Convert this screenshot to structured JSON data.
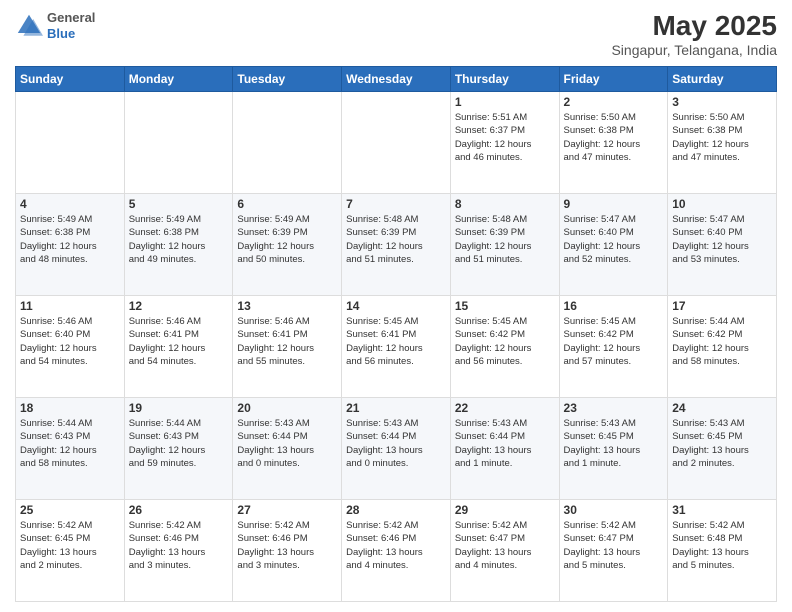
{
  "header": {
    "logo": {
      "general": "General",
      "blue": "Blue"
    },
    "title": "May 2025",
    "subtitle": "Singapur, Telangana, India"
  },
  "days_of_week": [
    "Sunday",
    "Monday",
    "Tuesday",
    "Wednesday",
    "Thursday",
    "Friday",
    "Saturday"
  ],
  "weeks": [
    [
      {
        "day": "",
        "info": ""
      },
      {
        "day": "",
        "info": ""
      },
      {
        "day": "",
        "info": ""
      },
      {
        "day": "",
        "info": ""
      },
      {
        "day": "1",
        "info": "Sunrise: 5:51 AM\nSunset: 6:37 PM\nDaylight: 12 hours\nand 46 minutes."
      },
      {
        "day": "2",
        "info": "Sunrise: 5:50 AM\nSunset: 6:38 PM\nDaylight: 12 hours\nand 47 minutes."
      },
      {
        "day": "3",
        "info": "Sunrise: 5:50 AM\nSunset: 6:38 PM\nDaylight: 12 hours\nand 47 minutes."
      }
    ],
    [
      {
        "day": "4",
        "info": "Sunrise: 5:49 AM\nSunset: 6:38 PM\nDaylight: 12 hours\nand 48 minutes."
      },
      {
        "day": "5",
        "info": "Sunrise: 5:49 AM\nSunset: 6:38 PM\nDaylight: 12 hours\nand 49 minutes."
      },
      {
        "day": "6",
        "info": "Sunrise: 5:49 AM\nSunset: 6:39 PM\nDaylight: 12 hours\nand 50 minutes."
      },
      {
        "day": "7",
        "info": "Sunrise: 5:48 AM\nSunset: 6:39 PM\nDaylight: 12 hours\nand 51 minutes."
      },
      {
        "day": "8",
        "info": "Sunrise: 5:48 AM\nSunset: 6:39 PM\nDaylight: 12 hours\nand 51 minutes."
      },
      {
        "day": "9",
        "info": "Sunrise: 5:47 AM\nSunset: 6:40 PM\nDaylight: 12 hours\nand 52 minutes."
      },
      {
        "day": "10",
        "info": "Sunrise: 5:47 AM\nSunset: 6:40 PM\nDaylight: 12 hours\nand 53 minutes."
      }
    ],
    [
      {
        "day": "11",
        "info": "Sunrise: 5:46 AM\nSunset: 6:40 PM\nDaylight: 12 hours\nand 54 minutes."
      },
      {
        "day": "12",
        "info": "Sunrise: 5:46 AM\nSunset: 6:41 PM\nDaylight: 12 hours\nand 54 minutes."
      },
      {
        "day": "13",
        "info": "Sunrise: 5:46 AM\nSunset: 6:41 PM\nDaylight: 12 hours\nand 55 minutes."
      },
      {
        "day": "14",
        "info": "Sunrise: 5:45 AM\nSunset: 6:41 PM\nDaylight: 12 hours\nand 56 minutes."
      },
      {
        "day": "15",
        "info": "Sunrise: 5:45 AM\nSunset: 6:42 PM\nDaylight: 12 hours\nand 56 minutes."
      },
      {
        "day": "16",
        "info": "Sunrise: 5:45 AM\nSunset: 6:42 PM\nDaylight: 12 hours\nand 57 minutes."
      },
      {
        "day": "17",
        "info": "Sunrise: 5:44 AM\nSunset: 6:42 PM\nDaylight: 12 hours\nand 58 minutes."
      }
    ],
    [
      {
        "day": "18",
        "info": "Sunrise: 5:44 AM\nSunset: 6:43 PM\nDaylight: 12 hours\nand 58 minutes."
      },
      {
        "day": "19",
        "info": "Sunrise: 5:44 AM\nSunset: 6:43 PM\nDaylight: 12 hours\nand 59 minutes."
      },
      {
        "day": "20",
        "info": "Sunrise: 5:43 AM\nSunset: 6:44 PM\nDaylight: 13 hours\nand 0 minutes."
      },
      {
        "day": "21",
        "info": "Sunrise: 5:43 AM\nSunset: 6:44 PM\nDaylight: 13 hours\nand 0 minutes."
      },
      {
        "day": "22",
        "info": "Sunrise: 5:43 AM\nSunset: 6:44 PM\nDaylight: 13 hours\nand 1 minute."
      },
      {
        "day": "23",
        "info": "Sunrise: 5:43 AM\nSunset: 6:45 PM\nDaylight: 13 hours\nand 1 minute."
      },
      {
        "day": "24",
        "info": "Sunrise: 5:43 AM\nSunset: 6:45 PM\nDaylight: 13 hours\nand 2 minutes."
      }
    ],
    [
      {
        "day": "25",
        "info": "Sunrise: 5:42 AM\nSunset: 6:45 PM\nDaylight: 13 hours\nand 2 minutes."
      },
      {
        "day": "26",
        "info": "Sunrise: 5:42 AM\nSunset: 6:46 PM\nDaylight: 13 hours\nand 3 minutes."
      },
      {
        "day": "27",
        "info": "Sunrise: 5:42 AM\nSunset: 6:46 PM\nDaylight: 13 hours\nand 3 minutes."
      },
      {
        "day": "28",
        "info": "Sunrise: 5:42 AM\nSunset: 6:46 PM\nDaylight: 13 hours\nand 4 minutes."
      },
      {
        "day": "29",
        "info": "Sunrise: 5:42 AM\nSunset: 6:47 PM\nDaylight: 13 hours\nand 4 minutes."
      },
      {
        "day": "30",
        "info": "Sunrise: 5:42 AM\nSunset: 6:47 PM\nDaylight: 13 hours\nand 5 minutes."
      },
      {
        "day": "31",
        "info": "Sunrise: 5:42 AM\nSunset: 6:48 PM\nDaylight: 13 hours\nand 5 minutes."
      }
    ]
  ]
}
